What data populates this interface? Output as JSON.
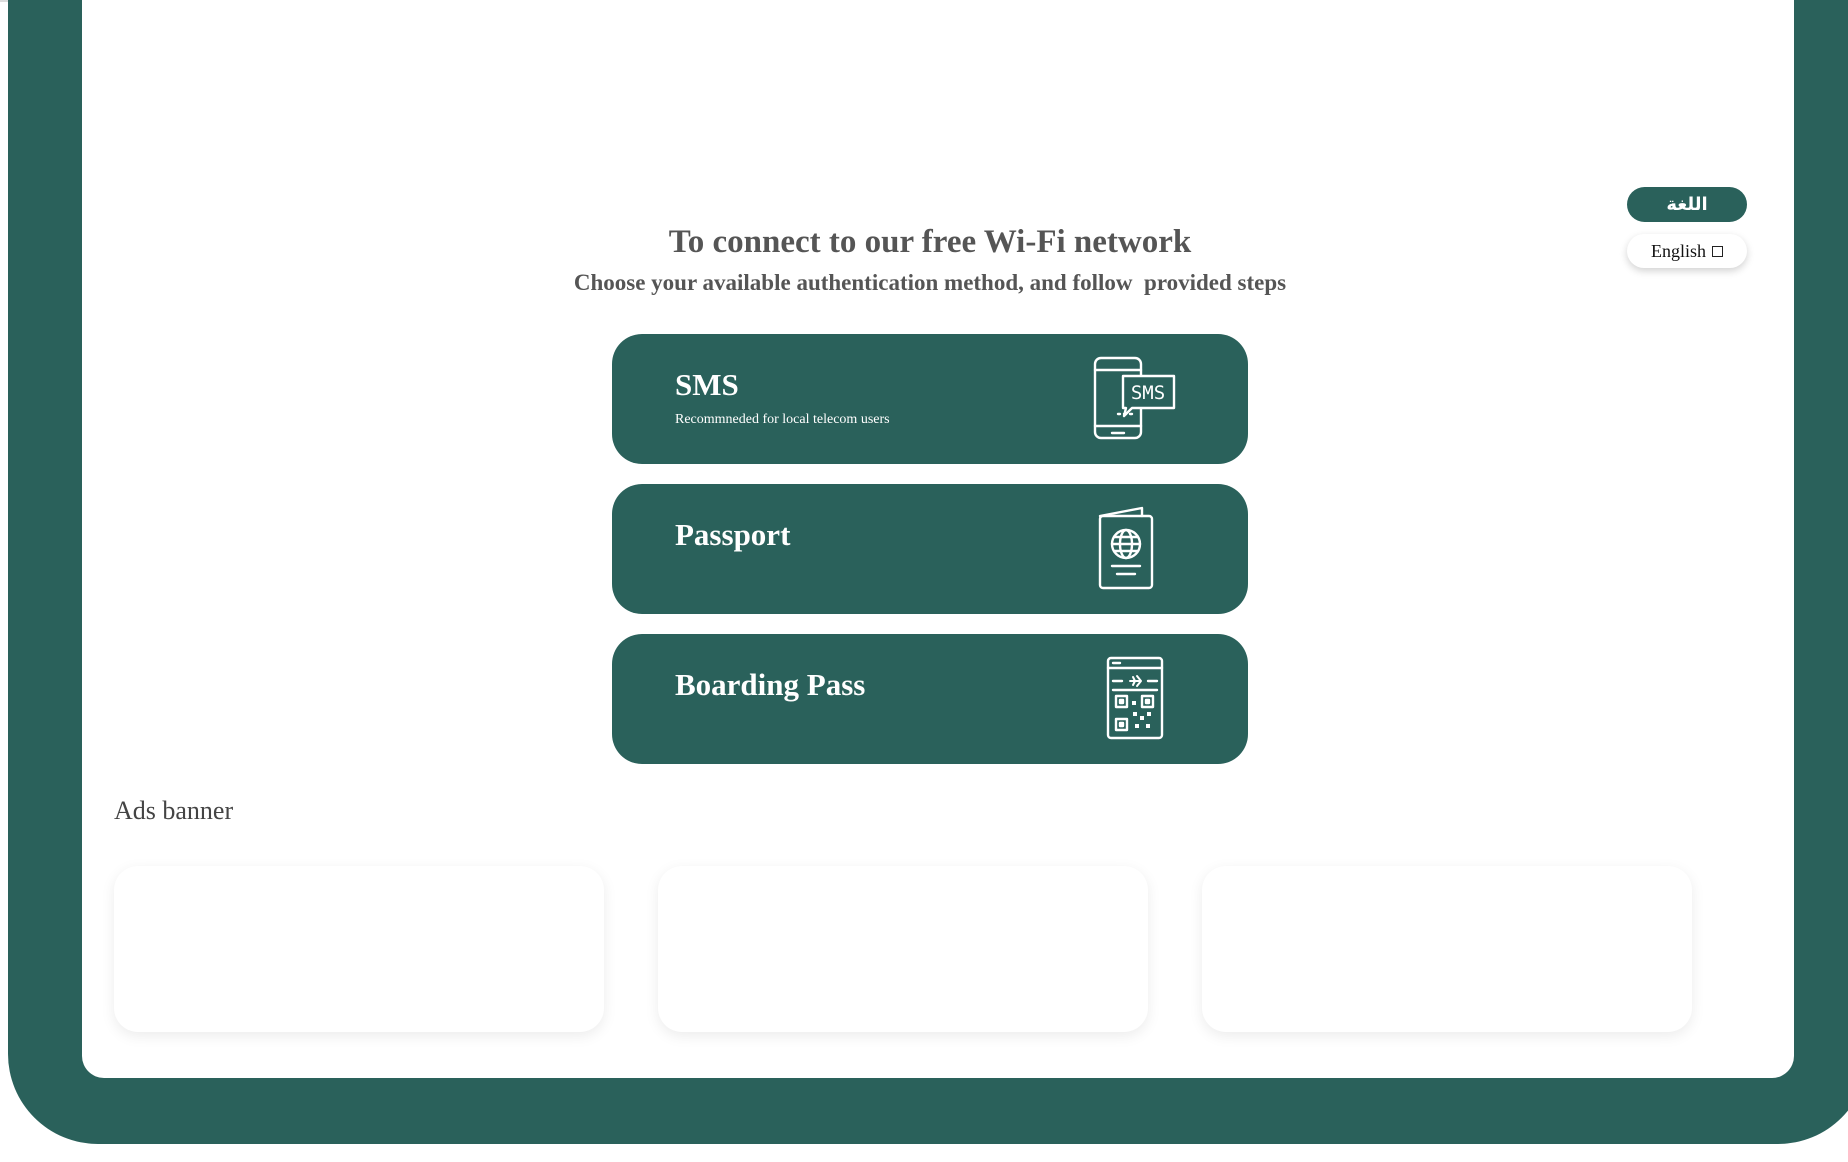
{
  "language": {
    "toggle_label": "اللغة",
    "option_label": "English"
  },
  "header": {
    "title": "To connect to our free Wi-Fi network",
    "subtitle": "Choose your available authentication method, and follow  provided steps"
  },
  "auth_methods": [
    {
      "title": "SMS",
      "subtitle": "Recommneded for local telecom users",
      "icon": "phone-sms-icon",
      "icon_text": "SMS"
    },
    {
      "title": "Passport",
      "subtitle": "",
      "icon": "passport-icon"
    },
    {
      "title": "Boarding Pass",
      "subtitle": "",
      "icon": "boarding-pass-icon"
    }
  ],
  "ads": {
    "title": "Ads banner",
    "slots": 3
  },
  "colors": {
    "brand": "#2a615b",
    "text": "#555555",
    "background": "#ffffff"
  }
}
